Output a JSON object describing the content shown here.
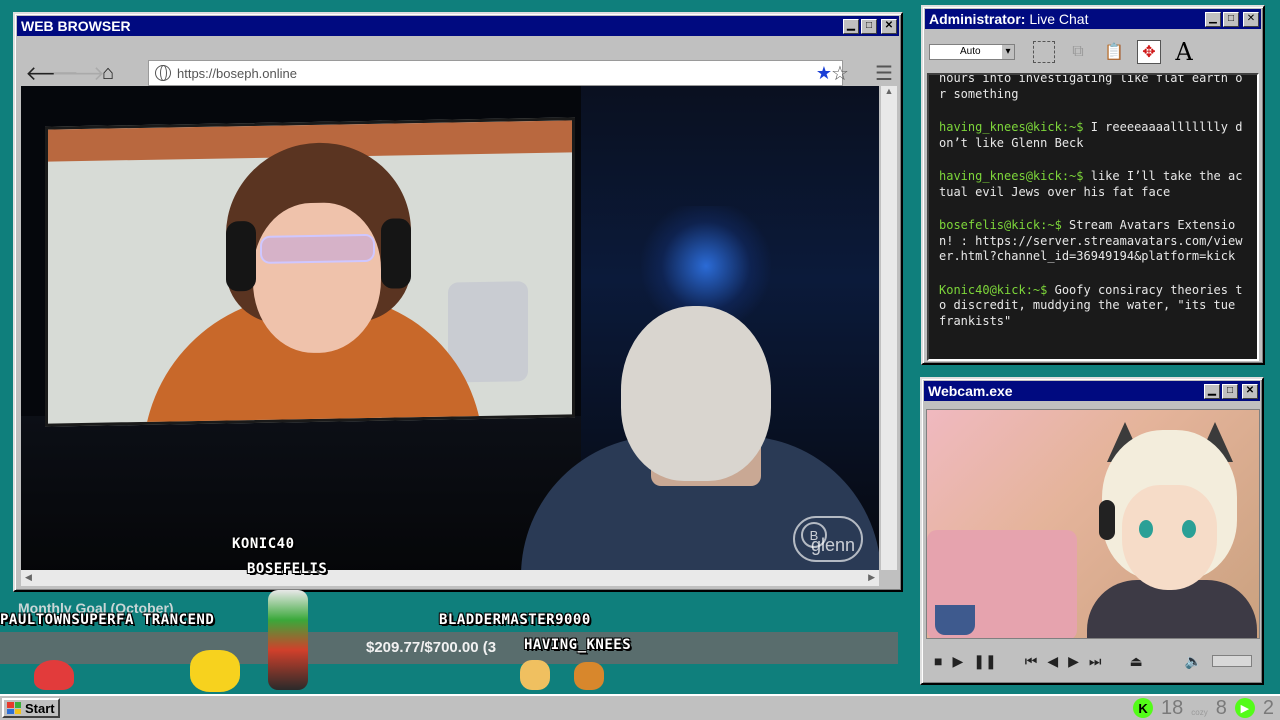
{
  "browser": {
    "title": "WEB BROWSER",
    "url": "https://boseph.online",
    "watermark": "glenn"
  },
  "chat": {
    "title_prefix": "Administrator:",
    "title_suffix": " Live Chat",
    "font_size_select": "Auto",
    "partial_line": "hours into investigating like flat earth or something",
    "messages": [
      {
        "user": "having_knees@kick:~$",
        "text": " I reeeeaaaallllllly don’t like Glenn Beck"
      },
      {
        "user": "having_knees@kick:~$",
        "text": " like I’ll take the actual evil Jews over his fat face"
      },
      {
        "user": "bosefelis@kick:~$",
        "text": " Stream Avatars Extension! : https://server.streamavatars.com/viewer.html?channel_id=36949194&platform=kick"
      },
      {
        "user": "Konic40@kick:~$",
        "text": " Goofy consiracy theories to discredit, muddying the water, \"its tue frankists\""
      }
    ]
  },
  "webcam": {
    "title": "Webcam.exe"
  },
  "overlay": {
    "goal_label": "Monthly Goal (October)",
    "goal_text": "$209.77/$700.00 (3",
    "avatars": [
      "KONIC40",
      "BOSEFELIS",
      "PAULTOWNSUPERFA TRANCEND",
      "BLADDERMASTER9000",
      "HAVING_KNEES"
    ]
  },
  "taskbar": {
    "start_label": "Start",
    "tray_count_1": "18",
    "tray_small": "cozy",
    "tray_count_2": "8",
    "tray_count_3": "2"
  },
  "colors": {
    "desktop": "#0f7f7c",
    "titlebar": "#000a80",
    "chat_user": "#7dd63a",
    "kick_green": "#53fc18"
  }
}
